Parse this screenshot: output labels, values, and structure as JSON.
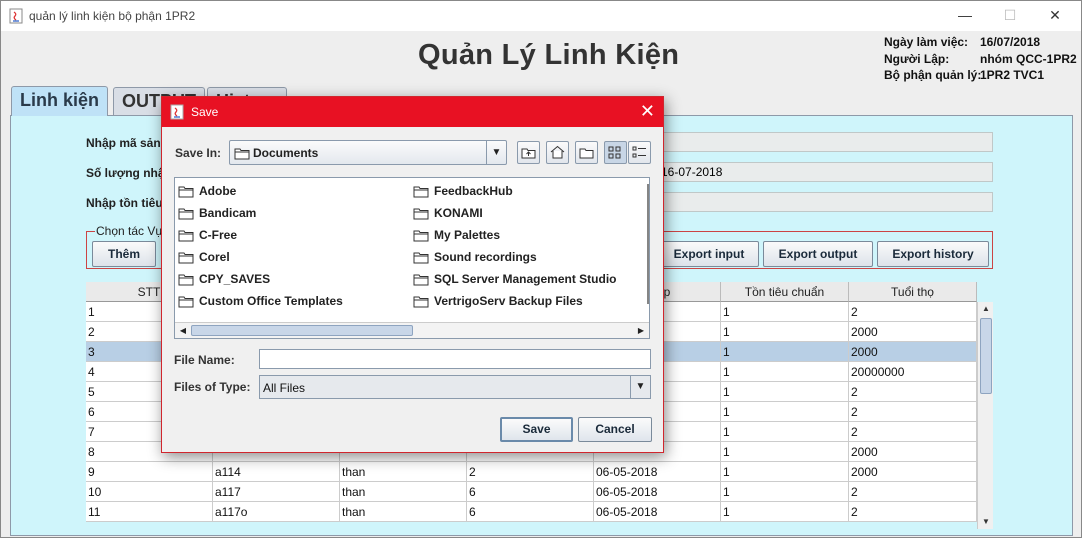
{
  "window": {
    "title": "quản lý linh kiện bộ phận 1PR2",
    "controls": [
      "—",
      "☐",
      "✕"
    ]
  },
  "app_title": "Quản Lý Linh Kiện",
  "info": {
    "work_date_label": "Ngày làm việc:",
    "work_date_value": "16/07/2018",
    "creator_label": "Người Lập:",
    "creator_value": "nhóm QCC-1PR2",
    "dept_label": "Bộ phận quản lý:",
    "dept_value": "1PR2 TVC1"
  },
  "tabs": [
    {
      "label": "Linh kiện",
      "active": true
    },
    {
      "label": "OUTPUT",
      "active": false
    },
    {
      "label": "History",
      "active": false
    }
  ],
  "form": {
    "product_code_label": "Nhập mã sản",
    "quantity_label": "Số lượng nhậ",
    "stock_label": "Nhập tồn tiêu",
    "date_field_value": "16-07-2018"
  },
  "operations": {
    "legend": "Chọn tác Vụ",
    "add_label": "Thêm",
    "export_input_label": "Export input",
    "export_output_label": "Export output",
    "export_history_label": "Export history"
  },
  "table": {
    "headers": [
      "STT",
      "",
      "",
      "",
      "nhập",
      "Tồn tiêu chuẩn",
      "Tuổi thọ"
    ],
    "rows": [
      [
        "1",
        "",
        "",
        "",
        "",
        "1",
        "2"
      ],
      [
        "2",
        "",
        "",
        "",
        "",
        "1",
        "2000"
      ],
      [
        "3",
        "",
        "",
        "",
        "",
        "1",
        "2000"
      ],
      [
        "4",
        "",
        "",
        "",
        "",
        "1",
        "20000000"
      ],
      [
        "5",
        "",
        "",
        "",
        "",
        "1",
        "2"
      ],
      [
        "6",
        "",
        "",
        "",
        "",
        "1",
        "2"
      ],
      [
        "7",
        "",
        "",
        "",
        "",
        "1",
        "2"
      ],
      [
        "8",
        "",
        "",
        "",
        "",
        "1",
        "2000"
      ],
      [
        "9",
        "a114",
        "than",
        "2",
        "06-05-2018",
        "1",
        "2000"
      ],
      [
        "10",
        "a117",
        "than",
        "6",
        "06-05-2018",
        "1",
        "2"
      ],
      [
        "11",
        "a117o",
        "than",
        "6",
        "06-05-2018",
        "1",
        "2"
      ]
    ],
    "selected_row": 3
  },
  "save_dialog": {
    "title": "Save",
    "close": "✕",
    "look_in_label": "Save In:",
    "look_in_value": "Documents",
    "files_col1": [
      "Adobe",
      "Bandicam",
      "C-Free",
      "Corel",
      "CPY_SAVES",
      "Custom Office Templates"
    ],
    "files_col2": [
      "FeedbackHub",
      "KONAMI",
      "My Palettes",
      "Sound recordings",
      "SQL Server Management Studio",
      "VertrigoServ Backup Files"
    ],
    "file_name_label": "File Name:",
    "file_name_value": "",
    "file_type_label": "Files of Type:",
    "file_type_value": "All Files",
    "save_label": "Save",
    "cancel_label": "Cancel"
  }
}
